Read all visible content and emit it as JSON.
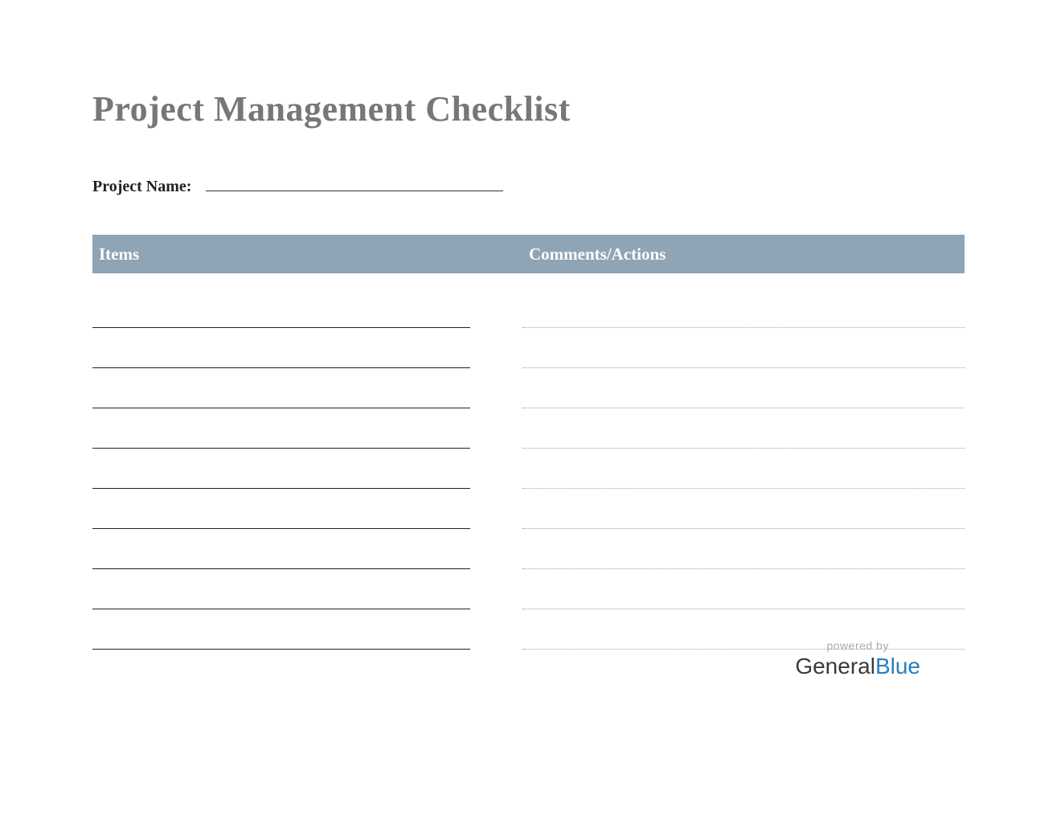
{
  "title": "Project Management Checklist",
  "project_name_label": "Project Name:",
  "table": {
    "headers": {
      "items": "Items",
      "comments": "Comments/Actions"
    },
    "row_count": 9
  },
  "footer": {
    "powered_by": "powered by",
    "brand_part1": "General",
    "brand_part2": "Blue"
  },
  "colors": {
    "header_bg": "#8fa4b5",
    "title_color": "#777",
    "brand_blue": "#2a7fbf"
  }
}
